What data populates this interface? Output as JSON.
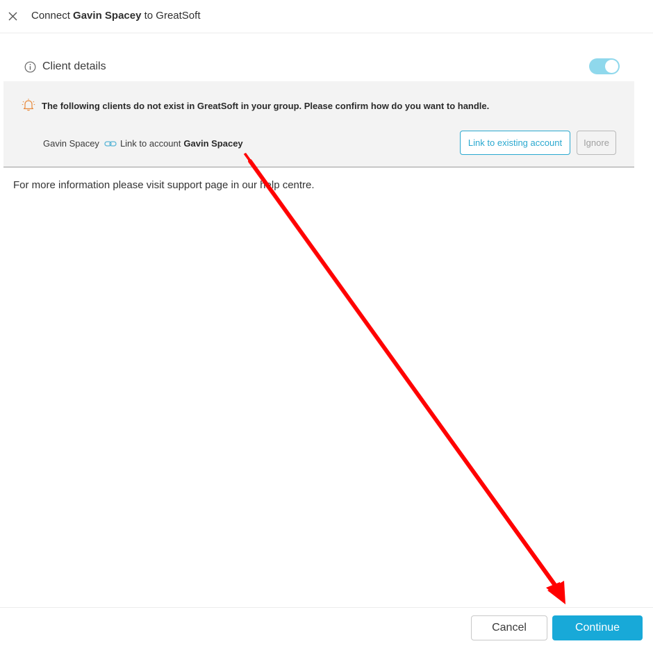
{
  "header": {
    "title_prefix": "Connect",
    "client_name": "Gavin Spacey",
    "title_suffix": "to GreatSoft"
  },
  "client_details": {
    "label": "Client details",
    "toggle_on": true
  },
  "warning": {
    "message": "The following clients do not exist in GreatSoft in your group. Please confirm how do you want to handle.",
    "client_name": "Gavin Spacey",
    "link_text": "Link to account",
    "account_name": "Gavin Spacey",
    "link_button_label": "Link to existing account",
    "ignore_button_label": "Ignore"
  },
  "info_text": "For more information please visit support page in our help centre.",
  "footer": {
    "cancel_label": "Cancel",
    "continue_label": "Continue"
  },
  "colors": {
    "accent": "#18a9d8",
    "toggle": "#8fd8ec",
    "warning_icon": "#e8893a",
    "annotation_arrow": "#ff0000"
  },
  "icons": {
    "close": "close-icon",
    "info": "info-icon",
    "bell": "bell-icon",
    "link": "link-icon"
  }
}
